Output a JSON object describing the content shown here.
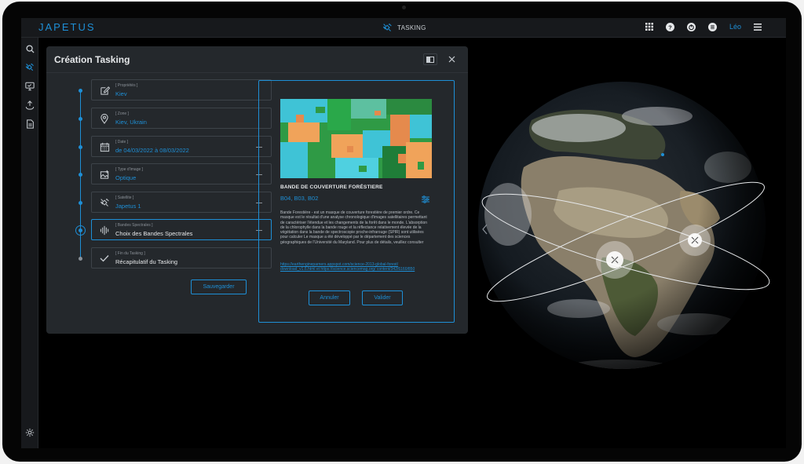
{
  "app": {
    "logo": "JAPETUS",
    "center_title": "TASKING",
    "user": "Léo"
  },
  "panel": {
    "title": "Création Tasking",
    "save_label": "Sauvegarder",
    "steps": [
      {
        "label": "[ Propriétés ]",
        "value": "Kiev",
        "icon": "edit-icon"
      },
      {
        "label": "[ Zone ]",
        "value": "Kiev, Ukrain",
        "icon": "location-pin-icon"
      },
      {
        "label": "[ Date ]",
        "value": "de 04/03/2022  à  08/03/2022",
        "icon": "calendar-icon"
      },
      {
        "label": "[ Type d'image ]",
        "value": "Optique",
        "icon": "image-type-icon"
      },
      {
        "label": "[ Satellite ]",
        "value": "Japetus 1",
        "icon": "satellite-icon"
      },
      {
        "label": "[ Bandes Spectrales ]",
        "value": "Choix des Bandes Spectrales",
        "icon": "spectral-bands-icon"
      },
      {
        "label": "[ Fin du Tasking ]",
        "value": "Récapitulatif du Tasking",
        "icon": "check-icon"
      }
    ]
  },
  "card": {
    "title": "BANDE DE COUVERTURE FORÉSTIERE",
    "bands": "B04, B03, B02",
    "description": "Bande Forestière - est un masque de couverture forestière de premier ordre. Ce masque est le résultat d'une analyse chronologique d'images satellitaires permettant de caractériser l'étendue et les changements de la forêt dans le monde. L'absorption de la chlorophylle dans la bande rouge et la réflectance relativement élevée de la végétation dans la bande de spectroscopie proche-infrarouge (SPIR) sont utilisées pour calculer Le masque a été développé par le département des sciences géographiques de l'Université du Maryland. Pour plus de détails, veuillez consulter",
    "link": "https://earthengineparners.appspot.com/science-2013-global-forest/ download_v1.6.html et https://science.sciencemag.org/ content/342/6160/850",
    "cancel_label": "Annuler",
    "validate_label": "Valider"
  },
  "colors": {
    "accent": "#1e8fd6",
    "panel_bg": "#24282c",
    "bar_bg": "#17191c"
  }
}
